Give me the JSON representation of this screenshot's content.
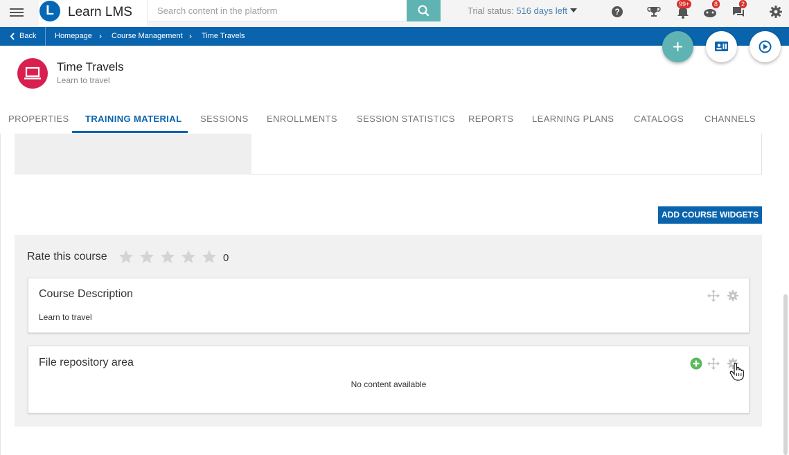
{
  "app": {
    "name": "Learn LMS",
    "logo_letter": "L"
  },
  "search": {
    "placeholder": "Search content in the platform"
  },
  "trial": {
    "prefix": "Trial status:",
    "days": "516 days left"
  },
  "badges": {
    "notifications": "99+",
    "gamification": "8",
    "messages": "2"
  },
  "breadcrumb": {
    "back_label": "Back",
    "items": [
      "Homepage",
      "Course Management",
      "Time Travels"
    ]
  },
  "course": {
    "title": "Time Travels",
    "subtitle": "Learn to travel"
  },
  "tabs": [
    {
      "label": "PROPERTIES"
    },
    {
      "label": "TRAINING MATERIAL"
    },
    {
      "label": "SESSIONS"
    },
    {
      "label": "ENROLLMENTS"
    },
    {
      "label": "SESSION STATISTICS"
    },
    {
      "label": "REPORTS"
    },
    {
      "label": "LEARNING PLANS"
    },
    {
      "label": "CATALOGS"
    },
    {
      "label": "CHANNELS"
    }
  ],
  "actions": {
    "add_widgets": "ADD COURSE WIDGETS"
  },
  "rating": {
    "label": "Rate this course",
    "count": "0",
    "max_stars": 5
  },
  "widgets": {
    "description": {
      "title": "Course Description",
      "body": "Learn to travel"
    },
    "files": {
      "title": "File repository area",
      "empty": "No content available"
    }
  },
  "colors": {
    "brand": "#0a64ad",
    "accent": "#5fb3b3",
    "course_icon": "#d81f4f",
    "badge": "#d9302c"
  }
}
